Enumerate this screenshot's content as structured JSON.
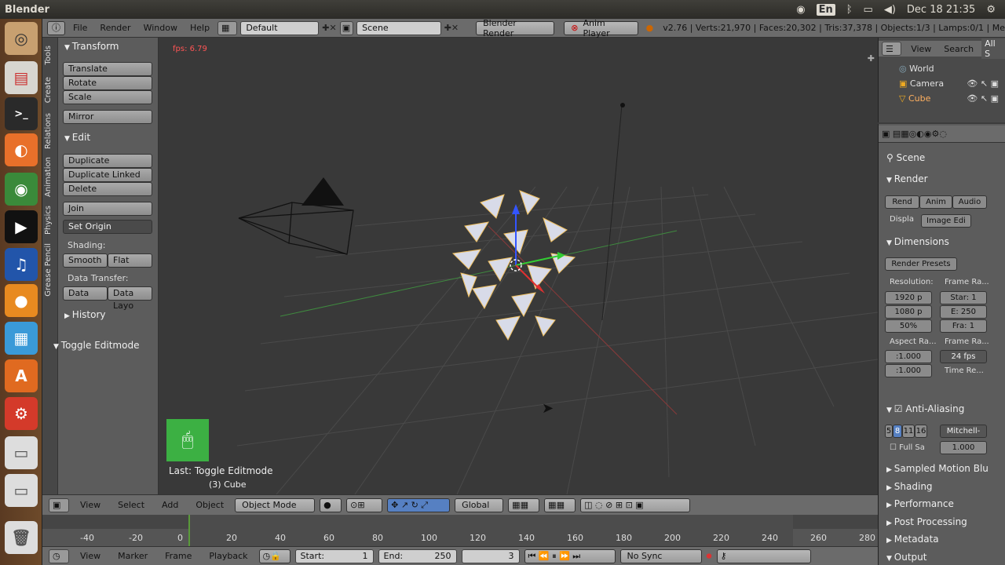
{
  "os": {
    "app_name": "Blender",
    "lang": "En",
    "clock": "Dec 18 21:35"
  },
  "header": {
    "menus": [
      "File",
      "Render",
      "Window",
      "Help"
    ],
    "layout": "Default",
    "scene": "Scene",
    "engine": "Blender Render",
    "anim_player": "Anim Player",
    "stats": "v2.76 | Verts:21,970 | Faces:20,302 | Tris:37,378 | Objects:1/3 | Lamps:0/1 | Me"
  },
  "tool_tabs": [
    "Tools",
    "Create",
    "Relations",
    "Animation",
    "Physics",
    "Grease Pencil"
  ],
  "toolshelf": {
    "transform": "Transform",
    "translate": "Translate",
    "rotate": "Rotate",
    "scale": "Scale",
    "mirror": "Mirror",
    "edit": "Edit",
    "duplicate": "Duplicate",
    "duplicate_linked": "Duplicate Linked",
    "delete": "Delete",
    "join": "Join",
    "set_origin": "Set Origin",
    "shading": "Shading:",
    "smooth": "Smooth",
    "flat": "Flat",
    "data_transfer": "Data Transfer:",
    "data": "Data",
    "data_layout": "Data Layo",
    "history": "History",
    "toggle_editmode": "Toggle Editmode"
  },
  "viewport": {
    "fps": "fps: 6.79",
    "last_op": "Last: Toggle Editmode",
    "object_name": "(3) Cube"
  },
  "view_header": {
    "menus": [
      "View",
      "Select",
      "Add",
      "Object"
    ],
    "mode": "Object Mode",
    "orientation": "Global"
  },
  "timeline": {
    "ticks": [
      "-40",
      "-20",
      "0",
      "20",
      "40",
      "60",
      "80",
      "100",
      "120",
      "140",
      "160",
      "180",
      "200",
      "220",
      "240",
      "260",
      "280"
    ],
    "menus": [
      "View",
      "Marker",
      "Frame",
      "Playback"
    ],
    "start_label": "Start:",
    "start_value": "1",
    "end_label": "End:",
    "end_value": "250",
    "current": "3",
    "sync": "No Sync"
  },
  "outliner": {
    "view": "View",
    "search": "Search",
    "all": "All S",
    "items": [
      "World",
      "Camera",
      "Cube"
    ]
  },
  "properties": {
    "scene": "Scene",
    "render": "Render",
    "rend_btn": "Rend",
    "anim_btn": "Anim",
    "audio_btn": "Audio",
    "display_label": "Displa",
    "display_value": "Image Edi",
    "dimensions": "Dimensions",
    "render_presets": "Render Presets",
    "resolution": "Resolution:",
    "res_x": "1920 p",
    "res_y": "1080 p",
    "res_pct": "50%",
    "frame_range": "Frame Ra...",
    "start": "Star: 1",
    "end": "E: 250",
    "frame": "Fra: 1",
    "aspect": "Aspect Ra...",
    "asp_x": ":1.000",
    "asp_y": ":1.000",
    "frame_rate": "Frame Ra...",
    "fps": "24 fps",
    "time_remap": "Time Re...",
    "anti_aliasing": "Anti-Aliasing",
    "aa_samples": [
      "5",
      "8",
      "11",
      "16"
    ],
    "aa_filter": "Mitchell-",
    "full_sample": "Full Sa",
    "filter_size": "1.000",
    "sampled_motion": "Sampled Motion Blu",
    "shading": "Shading",
    "performance": "Performance",
    "post_processing": "Post Processing",
    "metadata": "Metadata",
    "output": "Output"
  }
}
